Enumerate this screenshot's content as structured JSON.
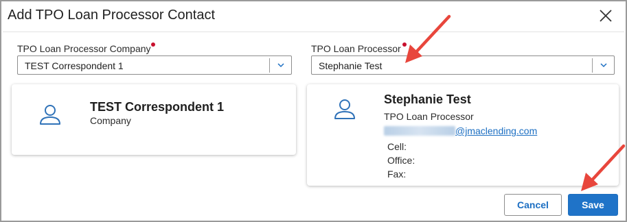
{
  "dialog": {
    "title": "Add TPO Loan Processor Contact"
  },
  "company_field": {
    "label": "TPO Loan Processor Company",
    "value": "TEST Correspondent 1"
  },
  "processor_field": {
    "label": "TPO Loan Processor",
    "value": "Stephanie Test"
  },
  "company_card": {
    "name": "TEST Correspondent 1",
    "subtitle": "Company"
  },
  "processor_card": {
    "name": "Stephanie Test",
    "role": "TPO Loan Processor",
    "email_domain": "@jmaclending.com",
    "cell_label": "Cell:",
    "office_label": "Office:",
    "fax_label": "Fax:"
  },
  "buttons": {
    "cancel": "Cancel",
    "save": "Save"
  },
  "colors": {
    "accent": "#1f73c8",
    "required": "#c8102e",
    "annotation_arrow": "#e8463c",
    "icon": "#2f72b8"
  },
  "icons": [
    "close-icon",
    "chevron-down-icon",
    "person-icon"
  ]
}
